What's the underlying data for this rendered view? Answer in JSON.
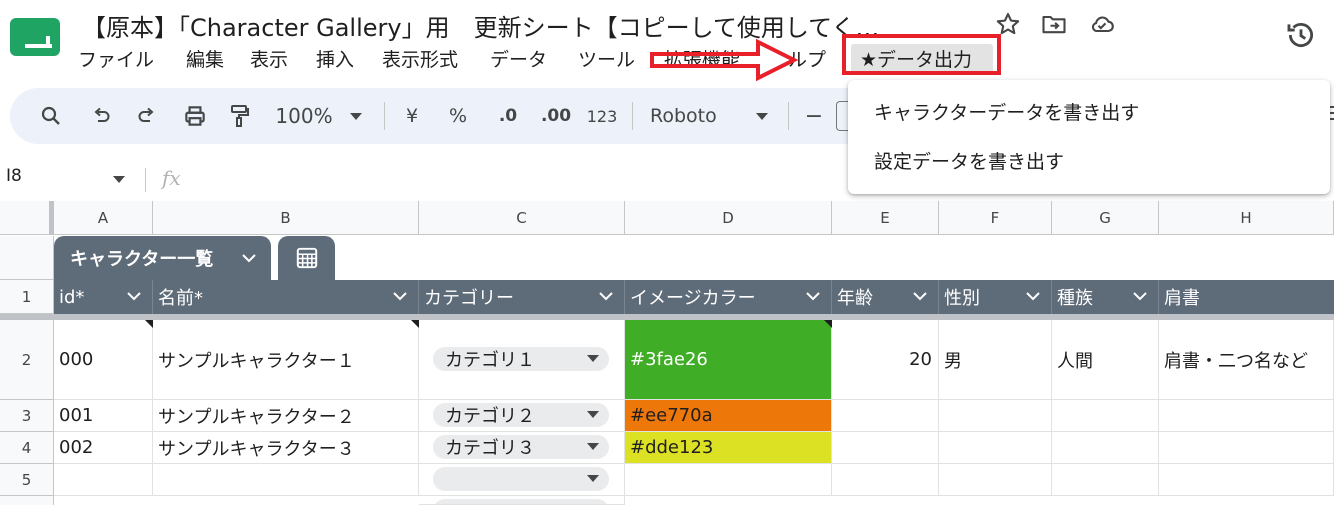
{
  "header": {
    "title": "【原本】「Character Gallery」用　更新シート【コピーして使用してく…",
    "icons": [
      "star-icon",
      "move-to-folder-icon",
      "cloud-saved-icon",
      "version-history-icon"
    ]
  },
  "menu": {
    "items": [
      "ファイル",
      "編集",
      "表示",
      "挿入",
      "表示形式",
      "データ",
      "ツール",
      "拡張機能",
      "ルプ",
      "★データ出力"
    ],
    "active": "★データ出力"
  },
  "toolbar": {
    "zoom": "100%",
    "currency": "¥",
    "percent": "%",
    "dec_decrease": ".0",
    "dec_increase": ".00",
    "number_format": "123",
    "font": "Roboto",
    "minus": "−"
  },
  "formula_bar": {
    "cell_ref": "I8",
    "fx": "fx"
  },
  "columns": [
    "A",
    "B",
    "C",
    "D",
    "E",
    "F",
    "G",
    "H"
  ],
  "rows": [
    "1",
    "2",
    "3",
    "4",
    "5"
  ],
  "table": {
    "name": "キャラクター一覧",
    "headers": [
      "id*",
      "名前*",
      "カテゴリー",
      "イメージカラー",
      "年齢",
      "性別",
      "種族",
      "肩書"
    ],
    "data": [
      {
        "id": "000",
        "name": "サンプルキャラクター１",
        "category": "カテゴリ１",
        "color": "#3fae26",
        "age": "20",
        "gender": "男",
        "race": "人間",
        "title": "肩書・二つ名など"
      },
      {
        "id": "001",
        "name": "サンプルキャラクター２",
        "category": "カテゴリ２",
        "color": "#ee770a",
        "age": "",
        "gender": "",
        "race": "",
        "title": ""
      },
      {
        "id": "002",
        "name": "サンプルキャラクター３",
        "category": "カテゴリ３",
        "color": "#dde123",
        "age": "",
        "gender": "",
        "race": "",
        "title": ""
      },
      {
        "id": "",
        "name": "",
        "category": "",
        "color": "",
        "age": "",
        "gender": "",
        "race": "",
        "title": ""
      }
    ]
  },
  "dropdown": {
    "items": [
      "キャラクターデータを書き出す",
      "設定データを書き出す"
    ]
  },
  "colors": {
    "annotation_red": "#e8202a",
    "table_header": "#5e6b78",
    "logo_green": "#1fa463"
  }
}
